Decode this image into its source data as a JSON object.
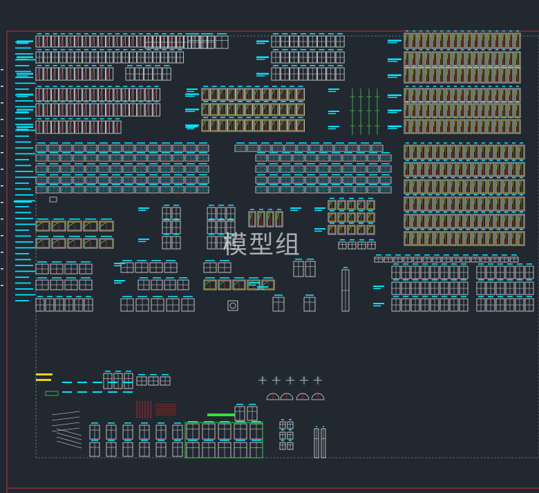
{
  "watermark": "模型组",
  "colors": {
    "background": "#212830",
    "frame": "#c8323c",
    "dashed_border": "#9aa0a6",
    "outline": "#e8e8e8",
    "label": "#00e5ff",
    "accent_red": "#ff2a2a",
    "accent_green": "#35e03a",
    "accent_yellow": "#e8d21a"
  }
}
